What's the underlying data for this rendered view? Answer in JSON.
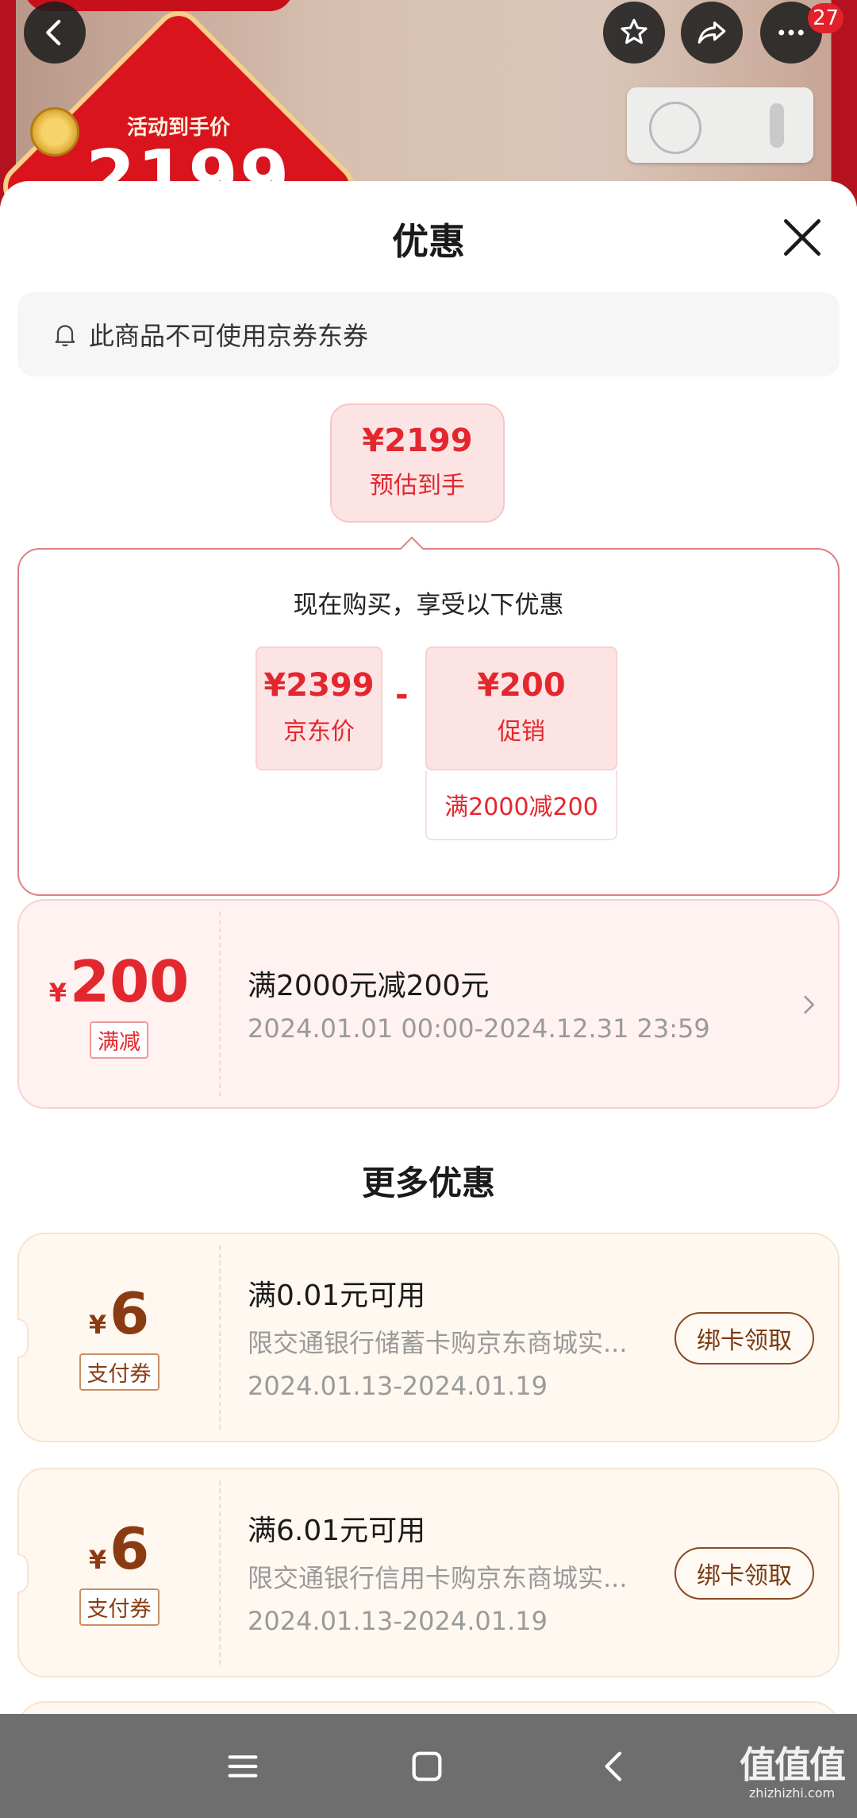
{
  "background": {
    "tag_label": "活动到手价",
    "tag_price": "2199",
    "badge_count": "27"
  },
  "sheet": {
    "title": "优惠",
    "notice": "此商品不可使用京券东券",
    "estimate": {
      "price": "¥2199",
      "label": "预估到手"
    },
    "breakdown": {
      "title": "现在购买，享受以下优惠",
      "base": {
        "price": "¥2399",
        "label": "京东价"
      },
      "operator": "-",
      "discount": {
        "price": "¥200",
        "label": "促销"
      },
      "condition": "满2000减200"
    },
    "promo": {
      "yen": "¥",
      "amount": "200",
      "tag": "满减",
      "title": "满2000元减200元",
      "period": "2024.01.01 00:00-2024.12.31 23:59"
    },
    "more_title": "更多优惠",
    "coupons": [
      {
        "yen": "¥",
        "amount": "6",
        "tag": "支付券",
        "title": "满0.01元可用",
        "desc": "限交通银行储蓄卡购京东商城实...",
        "period": "2024.01.13-2024.01.19",
        "button": "绑卡领取"
      },
      {
        "yen": "¥",
        "amount": "6",
        "tag": "支付券",
        "title": "满6.01元可用",
        "desc": "限交通银行信用卡购京东商城实...",
        "period": "2024.01.13-2024.01.19",
        "button": "绑卡领取"
      }
    ]
  },
  "watermark": {
    "main": "值值值",
    "sub": "zhizhizhi.com"
  },
  "colors": {
    "accent": "#e3272f",
    "coupon_brown": "#8a3b12",
    "nav_bg": "#6e6e6e"
  },
  "icons": [
    "back-icon",
    "star-icon",
    "share-icon",
    "more-icon",
    "close-icon",
    "bell-icon",
    "chevron-right-icon",
    "menu-icon",
    "home-icon",
    "nav-back-icon"
  ]
}
